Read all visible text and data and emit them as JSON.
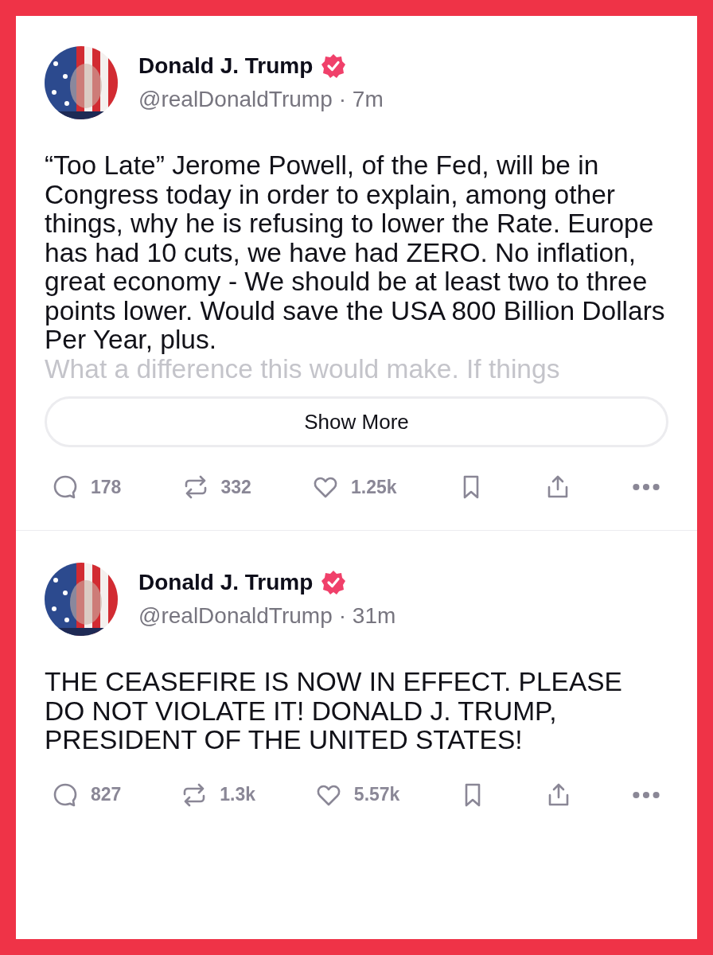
{
  "posts": [
    {
      "author": {
        "name": "Donald J. Trump",
        "verified": true,
        "handle": "@realDonaldTrump",
        "time": "· 7m"
      },
      "text": "“Too Late” Jerome Powell, of the Fed, will be in Congress today in order to explain, among other things, why he is refusing to lower the Rate. Europe has had 10 cuts, we have had ZERO. No inflation, great economy - We should be at least two to three points lower. Would save the USA 800 Billion Dollars Per Year, plus.",
      "faded_text": "What a difference this would make. If things",
      "show_more": "Show More",
      "actions": {
        "replies": "178",
        "reposts": "332",
        "likes": "1.25k"
      }
    },
    {
      "author": {
        "name": "Donald J. Trump",
        "verified": true,
        "handle": "@realDonaldTrump",
        "time": "· 31m"
      },
      "text": "THE CEASEFIRE IS NOW IN EFFECT. PLEASE DO NOT VIOLATE IT!  DONALD J. TRUMP, PRESIDENT OF THE UNITED STATES!",
      "actions": {
        "replies": "827",
        "reposts": "1.3k",
        "likes": "5.57k"
      }
    }
  ]
}
